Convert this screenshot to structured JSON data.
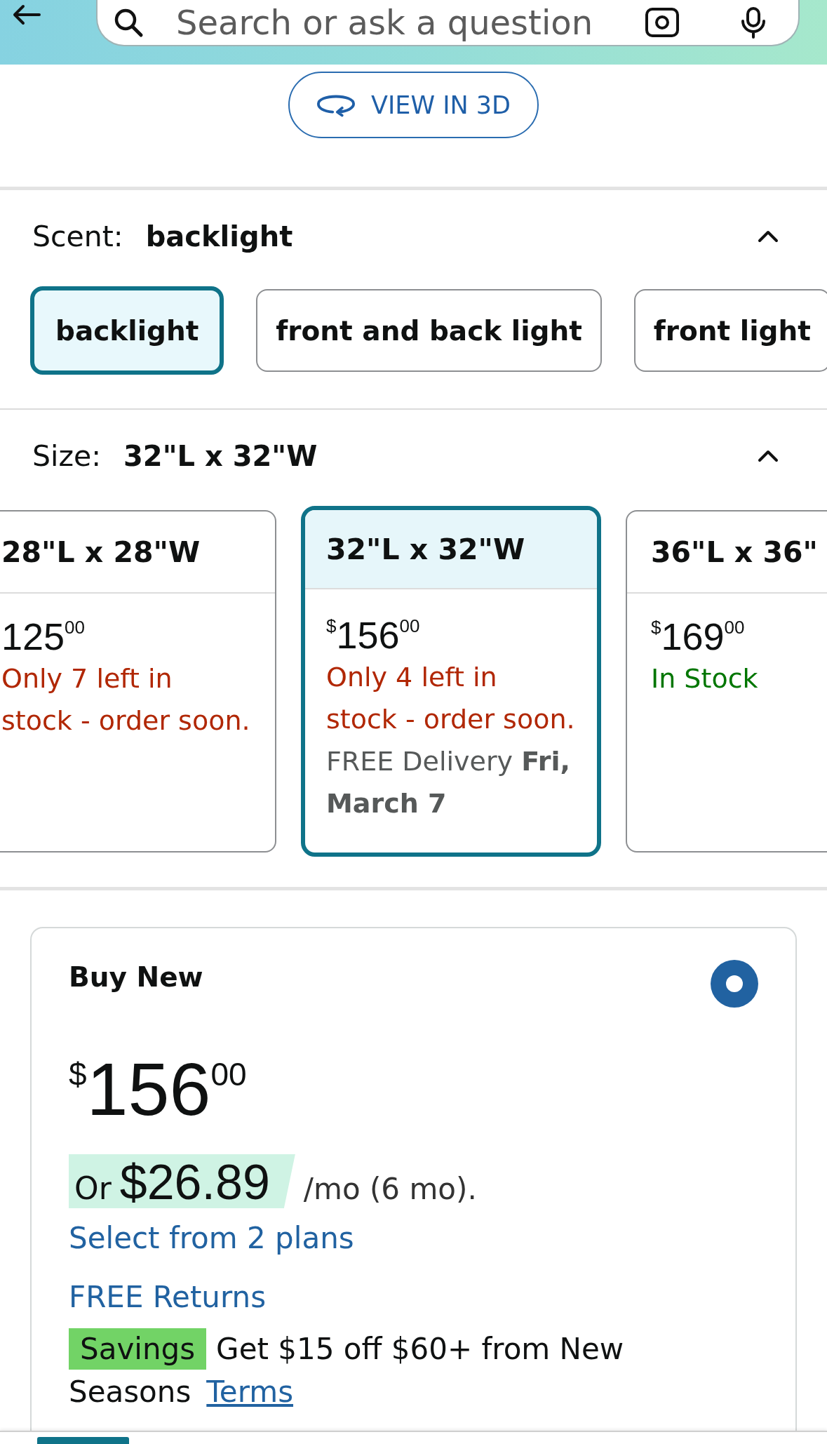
{
  "header": {
    "search": {
      "placeholder": "Search or ask a question"
    }
  },
  "view_3d_button": {
    "label": "VIEW IN 3D"
  },
  "scent": {
    "label": "Scent:",
    "value": "backlight",
    "expanded": true,
    "options": [
      {
        "label": "backlight",
        "selected": true
      },
      {
        "label": "front and back light",
        "selected": false
      },
      {
        "label": "front light",
        "selected": false
      }
    ]
  },
  "size": {
    "label": "Size:",
    "value": "32\"L x 32\"W",
    "expanded": true,
    "options": [
      {
        "label": "28\"L x 28\"W",
        "selected": false,
        "price": {
          "whole": "125",
          "fraction": "00"
        },
        "availability": {
          "kind": "low_stock",
          "text": "Only 7 left in stock - order soon."
        }
      },
      {
        "label": "32\"L x 32\"W",
        "selected": true,
        "price": {
          "currency": "$",
          "whole": "156",
          "fraction": "00"
        },
        "availability": {
          "kind": "low_stock",
          "text": "Only 4 left in stock - order soon."
        },
        "delivery": "FREE Delivery **Fri, March 7**"
      },
      {
        "label": "36\"L x 36\"",
        "selected": false,
        "price": {
          "currency": "$",
          "whole": "169",
          "fraction": "00"
        },
        "availability": {
          "kind": "in_stock",
          "text": "In Stock"
        }
      }
    ]
  },
  "buy_box": {
    "title": "Buy New",
    "selected": true,
    "price": {
      "currency": "$",
      "whole": "156",
      "fraction": "00"
    },
    "financing": {
      "prefix": "Or",
      "amount": "$26.89",
      "term": "/mo (6 mo)."
    },
    "plans_link": "Select from 2 plans",
    "returns_link": "FREE Returns",
    "savings": {
      "badge": "Savings",
      "text": "Get $15 off $60+ from New Seasons",
      "link": "Terms"
    }
  }
}
